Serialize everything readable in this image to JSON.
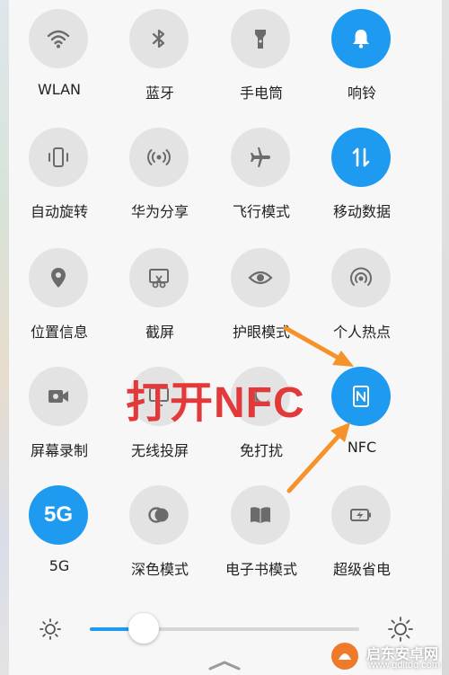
{
  "tiles": [
    {
      "label": "WLAN",
      "icon": "wifi-icon",
      "active": false
    },
    {
      "label": "蓝牙",
      "icon": "bluetooth-icon",
      "active": false
    },
    {
      "label": "手电筒",
      "icon": "flashlight-icon",
      "active": false
    },
    {
      "label": "响铃",
      "icon": "bell-icon",
      "active": true
    },
    {
      "label": "自动旋转",
      "icon": "auto-rotate-icon",
      "active": false
    },
    {
      "label": "华为分享",
      "icon": "huawei-share-icon",
      "active": false
    },
    {
      "label": "飞行模式",
      "icon": "airplane-icon",
      "active": false
    },
    {
      "label": "移动数据",
      "icon": "mobile-data-icon",
      "active": true
    },
    {
      "label": "位置信息",
      "icon": "location-icon",
      "active": false
    },
    {
      "label": "截屏",
      "icon": "screenshot-icon",
      "active": false
    },
    {
      "label": "护眼模式",
      "icon": "eye-icon",
      "active": false
    },
    {
      "label": "个人热点",
      "icon": "hotspot-icon",
      "active": false
    },
    {
      "label": "屏幕录制",
      "icon": "screen-record-icon",
      "active": false
    },
    {
      "label": "无线投屏",
      "icon": "wireless-projection-icon",
      "active": false
    },
    {
      "label": "免打扰",
      "icon": "do-not-disturb-icon",
      "active": false
    },
    {
      "label": "NFC",
      "icon": "nfc-icon",
      "active": true
    },
    {
      "label": "5G",
      "icon": "5g-icon",
      "active": true,
      "icon_text": "5G"
    },
    {
      "label": "深色模式",
      "icon": "dark-mode-icon",
      "active": false
    },
    {
      "label": "电子书模式",
      "icon": "ebook-icon",
      "active": false
    },
    {
      "label": "超级省电",
      "icon": "battery-saver-icon",
      "active": false
    }
  ],
  "annotation": "打开NFC",
  "brightness": {
    "level": 0.2
  },
  "colors": {
    "accent": "#1e9bf0",
    "inactive": "#e3e3e3",
    "icon_inactive": "#6b6b6b",
    "annotation": "#e23a3a",
    "arrow": "#f5922a"
  },
  "watermark": {
    "line1": "启东安卓网",
    "line2": "www.qdltdq.com"
  }
}
